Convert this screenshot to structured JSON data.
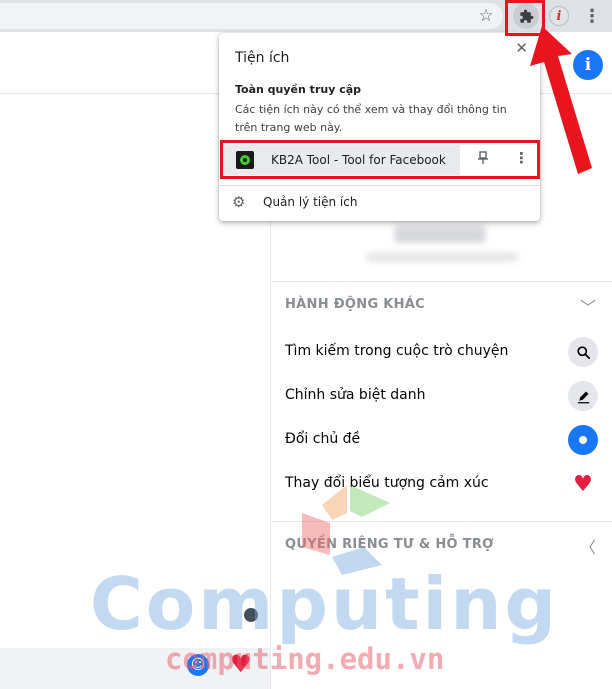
{
  "browser": {
    "star_icon": "star-icon",
    "extensions_icon": "puzzle-icon",
    "profile_letter": "i",
    "menu_icon": "kebab-icon"
  },
  "popup": {
    "title": "Tiện ích",
    "close_label": "✕",
    "access_heading": "Toàn quyền truy cập",
    "access_desc": "Các tiện ích này có thể xem và thay đổi thông tin trên trang web này.",
    "extension_name": "KB2A Tool - Tool for Facebook",
    "manage_label": "Quản lý tiện ích"
  },
  "panel": {
    "info_icon": "i",
    "other_actions_header": "HÀNH ĐỘNG KHÁC",
    "items": [
      {
        "label": "Tìm kiếm trong cuộc trò chuyện",
        "icon": "search-icon"
      },
      {
        "label": "Chỉnh sửa biệt danh",
        "icon": "pen-icon"
      },
      {
        "label": "Đổi chủ đề",
        "icon": "theme-icon"
      },
      {
        "label": "Thay đổi biểu tượng cảm xúc",
        "icon": "heart-icon"
      }
    ],
    "privacy_header": "QUYỀN RIÊNG TƯ & HỖ TRỢ"
  },
  "watermark": {
    "brand": "Computing",
    "url": "computing.edu.vn"
  },
  "colors": {
    "highlight": "#e8141e",
    "facebook_blue": "#1877f2",
    "heart_red": "#e41e3f"
  }
}
